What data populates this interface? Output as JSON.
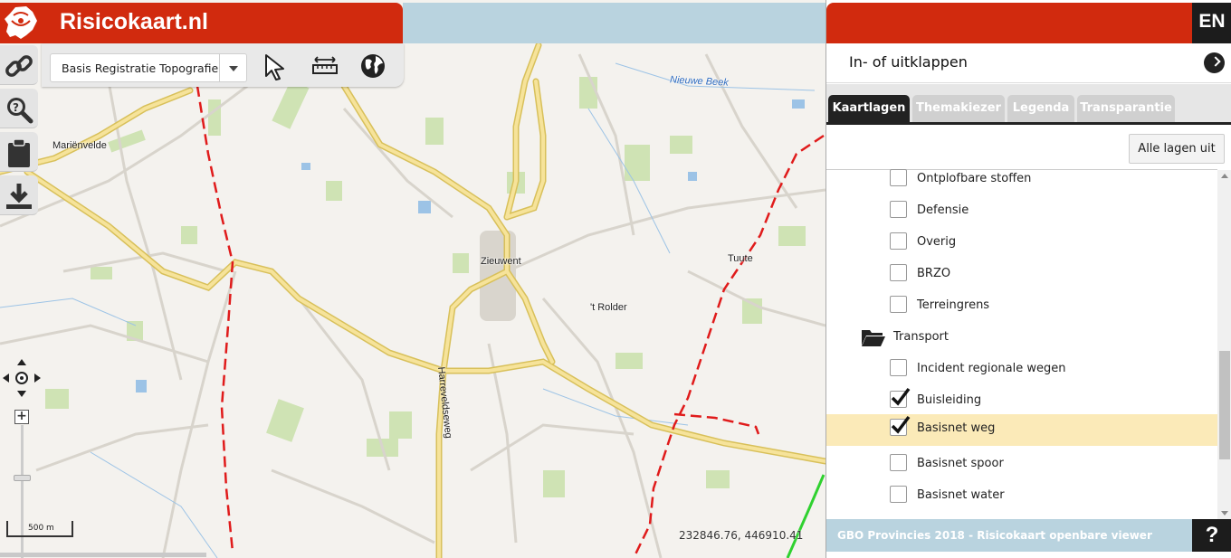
{
  "brand": {
    "title": "Risicokaart.nl"
  },
  "toolbar": {
    "layer_select_value": "Basis Registratie Topografie",
    "icons": [
      "pointer-icon",
      "measure-icon",
      "globe-icon"
    ]
  },
  "left_tools": [
    "link-icon",
    "search-icon",
    "clipboard-icon",
    "download-icon"
  ],
  "map": {
    "places": [
      {
        "name": "Mariënvelde"
      },
      {
        "name": "Zieuwent"
      },
      {
        "name": "Tuute"
      },
      {
        "name": "'t Rolder"
      }
    ],
    "water_label": "Nieuwe Beek",
    "road_label": "Harreveldseweg",
    "scale": "500 m",
    "coordinates": "232846.76, 446910.41"
  },
  "panel": {
    "lang": "EN",
    "toggle_label": "In- of uitklappen",
    "tabs": [
      {
        "label": "Kaartlagen",
        "active": true
      },
      {
        "label": "Themakiezer",
        "active": false
      },
      {
        "label": "Legenda",
        "active": false
      },
      {
        "label": "Transparantie",
        "active": false
      }
    ],
    "all_off_button": "Alle lagen uit",
    "layers": [
      {
        "label": "Ontplofbare stoffen",
        "checked": false
      },
      {
        "label": "Defensie",
        "checked": false
      },
      {
        "label": "Overig",
        "checked": false
      },
      {
        "label": "BRZO",
        "checked": false
      },
      {
        "label": "Terreingrens",
        "checked": false
      }
    ],
    "folder": {
      "label": "Transport"
    },
    "transport_layers": [
      {
        "label": "Incident regionale wegen",
        "checked": false
      },
      {
        "label": "Buisleiding",
        "checked": true
      },
      {
        "label": "Basisnet weg",
        "checked": true,
        "selected": true
      },
      {
        "label": "Basisnet spoor",
        "checked": false
      },
      {
        "label": "Basisnet water",
        "checked": false
      }
    ],
    "footer": "GBO Provincies 2018 - Risicokaart openbare viewer",
    "help": "?"
  },
  "colors": {
    "brand_red": "#d12a0e",
    "sky_blue": "#b9d3df",
    "selected_row": "#fbeab8",
    "dark": "#1c1c1c"
  }
}
